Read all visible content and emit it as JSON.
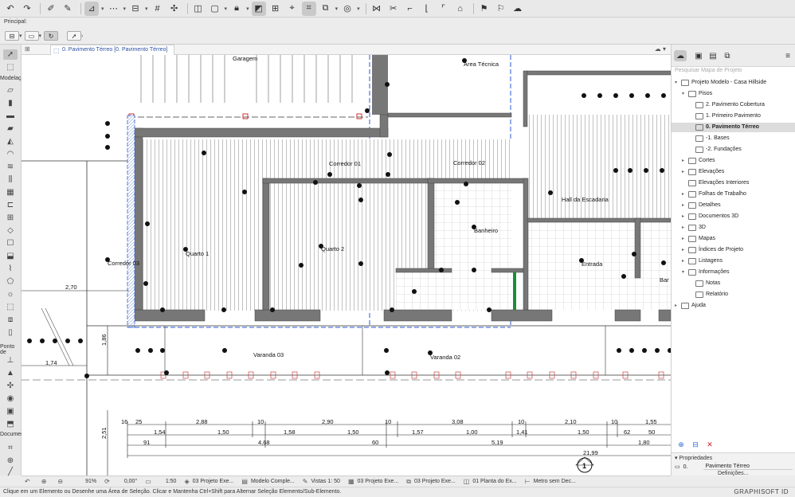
{
  "infobox": {
    "label": "Principal:"
  },
  "toolbox": {
    "groups": [
      "Modelação",
      "Ponto de",
      "Documen"
    ]
  },
  "view": {
    "active_tab": "0. Pavimento Térreo [0. Pavimento Térreo]"
  },
  "drawing": {
    "rooms": [
      "Garagem",
      "Área Técnica",
      "Corredor 01",
      "Corredor 02",
      "Hall da Escadaria",
      "Banheiro",
      "Quarto 1",
      "Quarto 2",
      "Corredor 03",
      "Entrada",
      "Bar",
      "Varanda 03",
      "Varanda 02"
    ],
    "dims_left": [
      "2,70",
      "1,74",
      "1,86",
      "2,51"
    ],
    "dims_row1": [
      "16",
      "25",
      "2,88",
      "10",
      "2,90",
      "10",
      "3,08",
      "10",
      "2,10",
      "10",
      "1,55"
    ],
    "dims_row2": [
      "1,54",
      "1,50",
      "1,58",
      "1,50",
      "1,57",
      "1,00",
      "1,41",
      "1,50",
      "62",
      "50"
    ],
    "dims_row3": [
      "91",
      "4,68",
      "60",
      "5,19",
      "1,80"
    ],
    "dims_total": "21,99",
    "section_marker": "1"
  },
  "quickbar": {
    "zoom": "91%",
    "angle": "0,00°",
    "scale": "1:50",
    "items": [
      "03 Projeto Exe...",
      "Modelo Comple...",
      "Vistas 1: 50",
      "03 Projeto Exe...",
      "03 Projeto Exe...",
      "01 Planta do Ex...",
      "Metro sem Dec..."
    ]
  },
  "status": {
    "message": "Clique em um Elemento ou Desenhe uma Área de Seleção. Clicar e Mantenha Ctrl+Shift para Alternar Seleção Elemento/Sub-Elemento.",
    "brand": "GRAPHISOFT ID"
  },
  "navigator": {
    "search_placeholder": "Pesquisar Mapa de Projeto",
    "tree": [
      {
        "label": "Projeto Modelo - Casa Hillside",
        "level": 0,
        "twisty": "▾"
      },
      {
        "label": "Pisos",
        "level": 1,
        "twisty": "▾"
      },
      {
        "label": "2. Pavimento Cobertura",
        "level": 2,
        "twisty": ""
      },
      {
        "label": "1. Primeiro Pavimento",
        "level": 2,
        "twisty": ""
      },
      {
        "label": "0. Pavimento Térreo",
        "level": 2,
        "twisty": "",
        "selected": true
      },
      {
        "label": "-1. Bases",
        "level": 2,
        "twisty": ""
      },
      {
        "label": "-2. Fundações",
        "level": 2,
        "twisty": ""
      },
      {
        "label": "Cortes",
        "level": 1,
        "twisty": "▸"
      },
      {
        "label": "Elevações",
        "level": 1,
        "twisty": "▸"
      },
      {
        "label": "Elevações Interiores",
        "level": 1,
        "twisty": ""
      },
      {
        "label": "Folhas de Trabalho",
        "level": 1,
        "twisty": "▸"
      },
      {
        "label": "Detalhes",
        "level": 1,
        "twisty": "▸"
      },
      {
        "label": "Documentos 3D",
        "level": 1,
        "twisty": "▸"
      },
      {
        "label": "3D",
        "level": 1,
        "twisty": "▸"
      },
      {
        "label": "Mapas",
        "level": 1,
        "twisty": "▸"
      },
      {
        "label": "Índices de Projeto",
        "level": 1,
        "twisty": "▸"
      },
      {
        "label": "Listagens",
        "level": 1,
        "twisty": "▸"
      },
      {
        "label": "Informações",
        "level": 1,
        "twisty": "▾"
      },
      {
        "label": "Notas",
        "level": 2,
        "twisty": ""
      },
      {
        "label": "Relatório",
        "level": 2,
        "twisty": ""
      },
      {
        "label": "Ajuda",
        "level": 0,
        "twisty": "▸"
      }
    ],
    "properties_title": "Propriedades",
    "props_key": "0.",
    "props_value": "Pavimento Térreo",
    "props_button": "Definições..."
  }
}
